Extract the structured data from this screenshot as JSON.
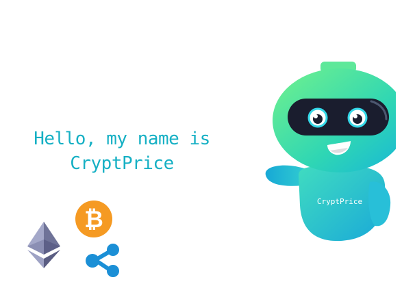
{
  "greeting": {
    "line1": "Hello, my name is",
    "line2": "CryptPrice"
  },
  "robot": {
    "chest_label": "CryptPrice"
  },
  "icons": {
    "bitcoin": "bitcoin-icon",
    "ethereum": "ethereum-icon",
    "ripple": "ripple-icon"
  },
  "colors": {
    "text": "#16b0c4",
    "bitcoin": "#f59a23",
    "ethereum": "#6c6f94",
    "ripple": "#1b8fd6",
    "robot_gradient_start": "#6ef28a",
    "robot_gradient_end": "#17b6d8",
    "visor": "#1a1d2e"
  }
}
